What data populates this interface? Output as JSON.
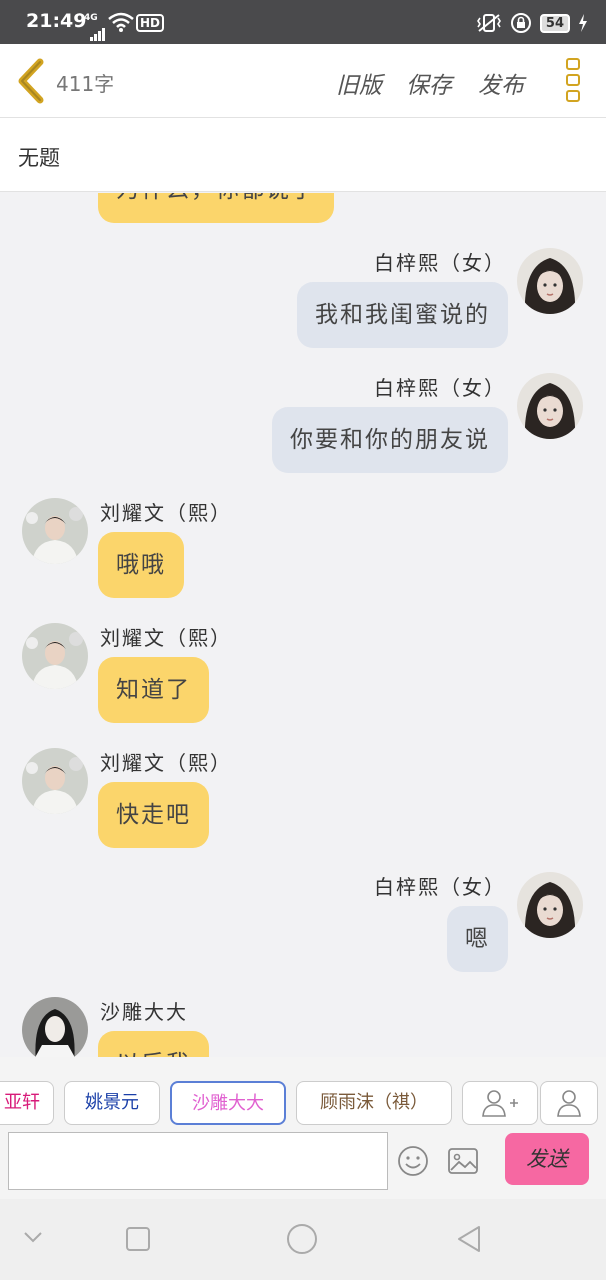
{
  "status_bar": {
    "time": "21:49",
    "network": "4G",
    "hd": "HD",
    "battery": "54"
  },
  "header": {
    "word_count": "411字",
    "old_version": "旧版",
    "save": "保存",
    "publish": "发布"
  },
  "document": {
    "title": "无题"
  },
  "messages": [
    {
      "side": "left",
      "name": "",
      "text": "为什么，你都说了",
      "color": "yellow"
    },
    {
      "side": "right",
      "name": "白梓熙（女）",
      "text": "我和我闺蜜说的",
      "color": "blue"
    },
    {
      "side": "right",
      "name": "白梓熙（女）",
      "text": "你要和你的朋友说",
      "color": "blue"
    },
    {
      "side": "left",
      "name": "刘耀文（熙）",
      "text": "哦哦",
      "color": "yellow"
    },
    {
      "side": "left",
      "name": "刘耀文（熙）",
      "text": "知道了",
      "color": "yellow"
    },
    {
      "side": "left",
      "name": "刘耀文（熙）",
      "text": "快走吧",
      "color": "yellow"
    },
    {
      "side": "right",
      "name": "白梓熙（女）",
      "text": "嗯",
      "color": "blue"
    },
    {
      "side": "left",
      "name": "沙雕大大",
      "text": "以后我",
      "color": "yellow"
    }
  ],
  "roles": [
    {
      "label": "亚轩",
      "color": "#d81b7a"
    },
    {
      "label": "姚景元",
      "color": "#1a3fa8"
    },
    {
      "label": "沙雕大大",
      "color": "#e060d0"
    },
    {
      "label": "顾雨沫（祺）",
      "color": "#7a5a3a"
    }
  ],
  "composer": {
    "send_label": "发送"
  },
  "colors": {
    "accent": "#d2a421",
    "bubble_yellow": "#fbd56b",
    "bubble_blue": "#dfe4ed",
    "send": "#f668a2"
  }
}
